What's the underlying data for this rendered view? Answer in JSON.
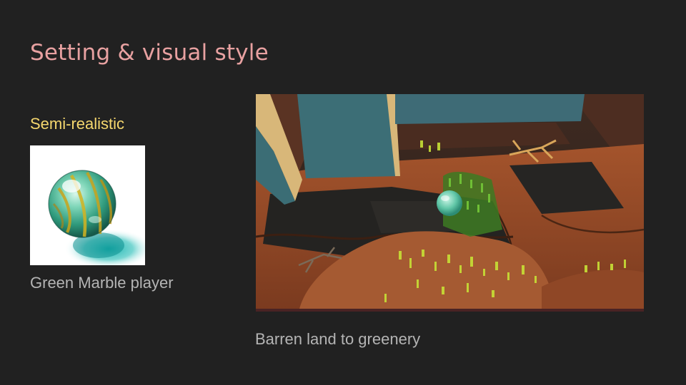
{
  "slide": {
    "title": "Setting & visual style",
    "subtitle": "Semi-realistic",
    "marble_caption": "Green Marble player",
    "scene_caption": "Barren land to greenery"
  },
  "images": {
    "marble": "green-glass-marble-photo",
    "scene": "game-screenshot-canyon-level"
  },
  "colors": {
    "background": "#212121",
    "title": "#e8a1a1",
    "subtitle": "#f5d76e",
    "caption": "#b4b4b4"
  }
}
